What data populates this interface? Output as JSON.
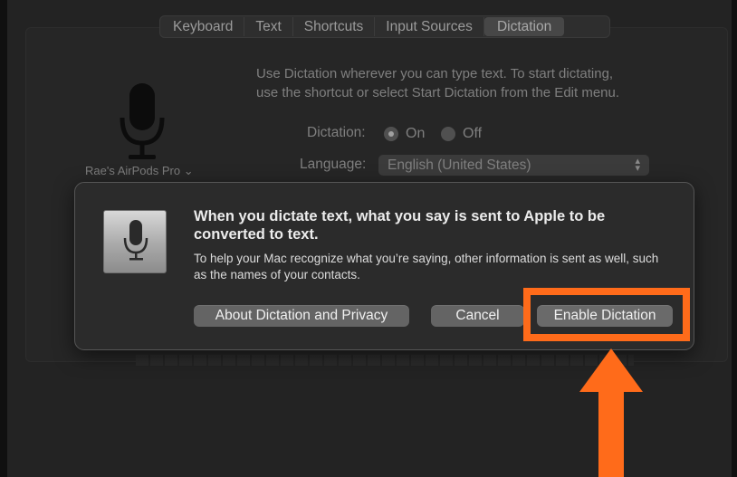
{
  "tabs": [
    {
      "label": "Keyboard"
    },
    {
      "label": "Text"
    },
    {
      "label": "Shortcuts"
    },
    {
      "label": "Input Sources"
    },
    {
      "label": "Dictation"
    }
  ],
  "active_tab": "Dictation",
  "dictation_pane": {
    "device_label": "Rae's AirPods Pro ⌄",
    "description_line1": "Use Dictation wherever you can type text. To start dictating,",
    "description_line2": "use the shortcut or select Start Dictation from the Edit menu.",
    "dictation_label": "Dictation:",
    "radio_on": "On",
    "radio_off": "Off",
    "dictation_selected": "On",
    "language_label": "Language:",
    "language_value": "English (United States)"
  },
  "dialog": {
    "title": "When you dictate text, what you say is sent to Apple to be converted to text.",
    "body": "To help your Mac recognize what you’re saying, other information is sent as well, such as the names of your contacts.",
    "buttons": {
      "about": "About Dictation and Privacy",
      "cancel": "Cancel",
      "enable": "Enable Dictation"
    }
  },
  "annotation": {
    "color": "#ff6b1a",
    "target": "Enable Dictation"
  },
  "icons": [
    "microphone-icon",
    "dictation-app-icon",
    "popup-chevron-icon",
    "arrow-up-icon"
  ]
}
